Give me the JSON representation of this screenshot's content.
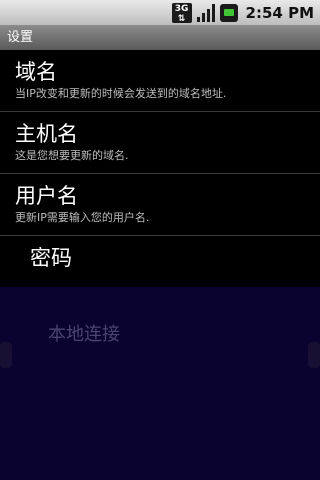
{
  "status_bar": {
    "network_label": "3G",
    "time": "2:54 PM",
    "icons": [
      "3g-data-icon",
      "signal-strength-icon",
      "battery-icon"
    ]
  },
  "title": "设置",
  "preferences": [
    {
      "title": "域名",
      "summary": "当IP改变和更新的时候会发送到的域名地址."
    },
    {
      "title": "主机名",
      "summary": "这是您想要更新的域名."
    },
    {
      "title": "用户名",
      "summary": "更新IP需要输入您的用户名."
    },
    {
      "title": "密码"
    }
  ],
  "overlay": {
    "label": "本地连接"
  },
  "colors": {
    "overlay": "#0a0330",
    "title_bar": "#6b6b6b",
    "summary_text": "#bdbdbd"
  }
}
